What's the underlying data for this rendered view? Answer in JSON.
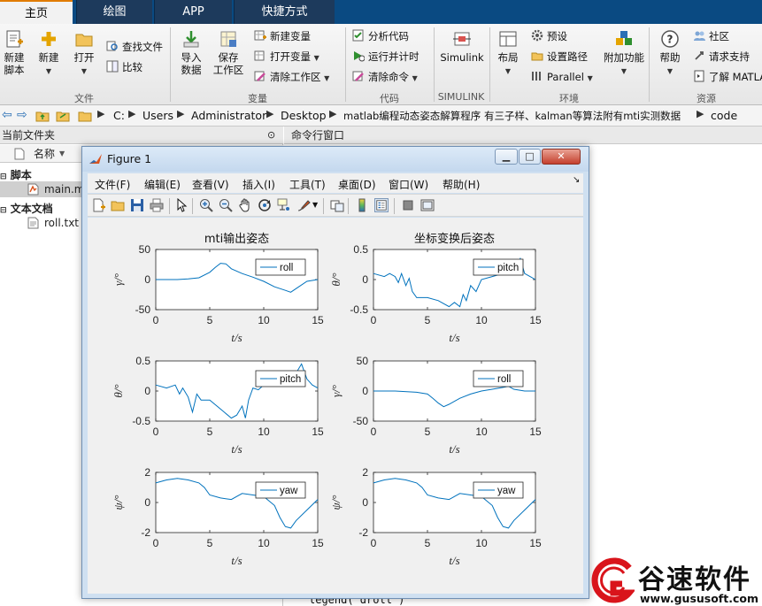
{
  "tabs": [
    {
      "label": "主页",
      "active": true
    },
    {
      "label": "绘图",
      "active": false
    },
    {
      "label": "APP",
      "active": false
    },
    {
      "label": "快捷方式",
      "active": false
    }
  ],
  "ribbon": {
    "file": {
      "new_script": "新建\n脚本",
      "new": "新建",
      "open": "打开",
      "find_files": "查找文件",
      "compare": "比较",
      "group_label": "文件"
    },
    "variable": {
      "import_data": "导入\n数据",
      "save_workspace": "保存\n工作区",
      "new_variable": "新建变量",
      "open_variable": "打开变量",
      "clear_workspace": "清除工作区",
      "group_label": "变量"
    },
    "code": {
      "analyze_code": "分析代码",
      "run_and_time": "运行并计时",
      "clear_commands": "清除命令",
      "group_label": "代码"
    },
    "simulink": {
      "simulink": "Simulink",
      "group_label": "SIMULINK"
    },
    "environment": {
      "layout": "布局",
      "preferences": "预设",
      "set_path": "设置路径",
      "parallel": "Parallel",
      "addons": "附加功能",
      "group_label": "环境"
    },
    "resources": {
      "help": "帮助",
      "community": "社区",
      "request_support": "请求支持",
      "learn_matlab": "了解 MATLAB",
      "group_label": "资源"
    }
  },
  "address_bar": {
    "path": [
      "C:",
      "Users",
      "Administrator",
      "Desktop",
      "matlab编程动态姿态解算程序 有三子样、kalman等算法附有mti实测数据",
      "code"
    ]
  },
  "current_folder": {
    "title": "当前文件夹",
    "column_name": "名称",
    "groups": [
      {
        "label": "脚本",
        "files": [
          "main.m"
        ]
      },
      {
        "label": "文本文档",
        "files": [
          "roll.txt"
        ]
      }
    ]
  },
  "command_window": {
    "title": "命令行窗口",
    "visible_line": "legend( droll )"
  },
  "figure": {
    "title": "Figure 1",
    "menu": [
      "文件(F)",
      "编辑(E)",
      "查看(V)",
      "插入(I)",
      "工具(T)",
      "桌面(D)",
      "窗口(W)",
      "帮助(H)"
    ],
    "toolbar_icons": [
      "new-figure-icon",
      "open-file-icon",
      "save-icon",
      "print-icon",
      "pointer-icon",
      "zoom-in-icon",
      "zoom-out-icon",
      "pan-icon",
      "rotate-icon",
      "data-cursor-icon",
      "brush-icon",
      "link-icon",
      "colorbar-icon",
      "legend-icon",
      "hide-tools-icon",
      "dock-icon"
    ]
  },
  "chart_data": [
    {
      "type": "line",
      "title": "mti输出姿态",
      "xlabel": "t/s",
      "ylabel": "γ/°",
      "xlim": [
        0,
        15
      ],
      "ylim": [
        -50,
        50
      ],
      "xticks": [
        0,
        5,
        10,
        15
      ],
      "yticks": [
        -50,
        0,
        50
      ],
      "grid": false,
      "legend": "top-right",
      "series": [
        {
          "name": "roll",
          "x": [
            0,
            2,
            3,
            4,
            5,
            5.5,
            6,
            6.5,
            7,
            8,
            9,
            10,
            11,
            12,
            12.5,
            13,
            14,
            15
          ],
          "y": [
            0,
            0,
            1,
            3,
            12,
            20,
            27,
            26,
            18,
            10,
            4,
            -3,
            -12,
            -18,
            -21,
            -15,
            -3,
            0
          ]
        }
      ]
    },
    {
      "type": "line",
      "title": "坐标变换后姿态",
      "xlabel": "t/s",
      "ylabel": "θ/°",
      "xlim": [
        0,
        15
      ],
      "ylim": [
        -0.5,
        0.5
      ],
      "xticks": [
        0,
        5,
        10,
        15
      ],
      "yticks": [
        -0.5,
        0,
        0.5
      ],
      "grid": false,
      "legend": "top-right",
      "series": [
        {
          "name": "pitch",
          "x": [
            0,
            1,
            1.5,
            2,
            2.3,
            2.6,
            3,
            3.3,
            3.6,
            4,
            5,
            6,
            7,
            7.5,
            8,
            8.3,
            8.6,
            9,
            9.5,
            10,
            11,
            12,
            13,
            13.6,
            14,
            14.5,
            15
          ],
          "y": [
            0.1,
            0.05,
            0.1,
            0.05,
            -0.05,
            0.1,
            -0.1,
            0.02,
            -0.2,
            -0.3,
            -0.3,
            -0.35,
            -0.45,
            -0.38,
            -0.45,
            -0.25,
            -0.35,
            -0.1,
            -0.2,
            0.0,
            0.05,
            0.1,
            0.15,
            0.35,
            0.1,
            0.05,
            0.0
          ]
        }
      ]
    },
    {
      "type": "line",
      "title": "",
      "xlabel": "t/s",
      "ylabel": "θ/°",
      "xlim": [
        0,
        15
      ],
      "ylim": [
        -0.5,
        0.5
      ],
      "xticks": [
        0,
        5,
        10,
        15
      ],
      "yticks": [
        -0.5,
        0,
        0.5
      ],
      "grid": false,
      "legend": "top-right",
      "series": [
        {
          "name": "pitch",
          "x": [
            0,
            1,
            1.8,
            2.2,
            2.5,
            3,
            3.4,
            3.8,
            4.2,
            5,
            6,
            7,
            7.5,
            8,
            8.3,
            8.6,
            9,
            9.5,
            10,
            11,
            12,
            13,
            13.5,
            14,
            14.5,
            15
          ],
          "y": [
            0.1,
            0.05,
            0.1,
            -0.05,
            0.05,
            -0.1,
            -0.35,
            -0.05,
            -0.15,
            -0.15,
            -0.3,
            -0.45,
            -0.4,
            -0.25,
            -0.45,
            -0.15,
            0.05,
            0.02,
            0.1,
            0.12,
            0.15,
            0.3,
            0.45,
            0.2,
            0.1,
            0.05
          ]
        }
      ]
    },
    {
      "type": "line",
      "title": "",
      "xlabel": "t/s",
      "ylabel": "γ/°",
      "xlim": [
        0,
        15
      ],
      "ylim": [
        -50,
        50
      ],
      "xticks": [
        0,
        5,
        10,
        15
      ],
      "yticks": [
        -50,
        0,
        50
      ],
      "grid": false,
      "legend": "top-right",
      "series": [
        {
          "name": "roll",
          "x": [
            0,
            2,
            4,
            5,
            5.5,
            6,
            6.5,
            7,
            8,
            9,
            10,
            11,
            12,
            12.5,
            13,
            14,
            15
          ],
          "y": [
            0,
            0,
            -2,
            -5,
            -12,
            -20,
            -26,
            -22,
            -12,
            -5,
            0,
            3,
            6,
            8,
            3,
            0,
            0
          ]
        }
      ]
    },
    {
      "type": "line",
      "title": "",
      "xlabel": "t/s",
      "ylabel": "ψ/°",
      "xlim": [
        0,
        15
      ],
      "ylim": [
        -2,
        2
      ],
      "xticks": [
        0,
        5,
        10,
        15
      ],
      "yticks": [
        -2,
        0,
        2
      ],
      "grid": false,
      "legend": "top-right",
      "series": [
        {
          "name": "yaw",
          "x": [
            0,
            1,
            2,
            3,
            4,
            4.5,
            5,
            6,
            7,
            8,
            9,
            10,
            11,
            11.5,
            12,
            12.5,
            13,
            14,
            15
          ],
          "y": [
            1.3,
            1.5,
            1.6,
            1.5,
            1.3,
            1.0,
            0.5,
            0.3,
            0.2,
            0.6,
            0.5,
            0.4,
            -0.2,
            -1.0,
            -1.6,
            -1.7,
            -1.2,
            -0.5,
            0.2
          ]
        }
      ]
    },
    {
      "type": "line",
      "title": "",
      "xlabel": "t/s",
      "ylabel": "ψ/°",
      "xlim": [
        0,
        15
      ],
      "ylim": [
        -2,
        2
      ],
      "xticks": [
        0,
        5,
        10,
        15
      ],
      "yticks": [
        -2,
        0,
        2
      ],
      "grid": false,
      "legend": "top-right",
      "series": [
        {
          "name": "yaw",
          "x": [
            0,
            1,
            2,
            3,
            4,
            4.5,
            5,
            6,
            7,
            8,
            9,
            10,
            11,
            11.5,
            12,
            12.5,
            13,
            14,
            15
          ],
          "y": [
            1.3,
            1.5,
            1.6,
            1.5,
            1.3,
            1.0,
            0.5,
            0.3,
            0.2,
            0.6,
            0.5,
            0.4,
            -0.2,
            -1.0,
            -1.6,
            -1.7,
            -1.2,
            -0.5,
            0.2
          ]
        }
      ]
    }
  ],
  "watermark": {
    "name": "谷速软件",
    "url": "www.gususoft.com",
    "brand_color": "#d9141b"
  },
  "colors": {
    "line": "#0072bd",
    "tab_bar": "#0a4a82",
    "tab_accent": "#e07b00"
  }
}
